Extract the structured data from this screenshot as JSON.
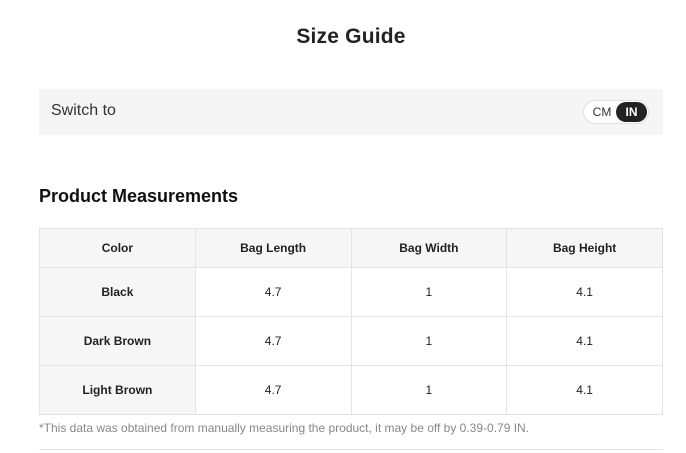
{
  "title": "Size Guide",
  "switch": {
    "label": "Switch to",
    "options": [
      "CM",
      "IN"
    ],
    "selected": "IN"
  },
  "section_title": "Product Measurements",
  "table": {
    "headers": [
      "Color",
      "Bag Length",
      "Bag Width",
      "Bag Height"
    ],
    "rows": [
      [
        "Black",
        "4.7",
        "1",
        "4.1"
      ],
      [
        "Dark Brown",
        "4.7",
        "1",
        "4.1"
      ],
      [
        "Light Brown",
        "4.7",
        "1",
        "4.1"
      ]
    ]
  },
  "footnote": "*This data was obtained from manually measuring the product, it may be off by 0.39-0.79 IN.",
  "colors": {
    "toggle_active_bg": "#222222",
    "switch_bar_bg": "#f5f5f5",
    "header_bg": "#f6f6f6"
  }
}
